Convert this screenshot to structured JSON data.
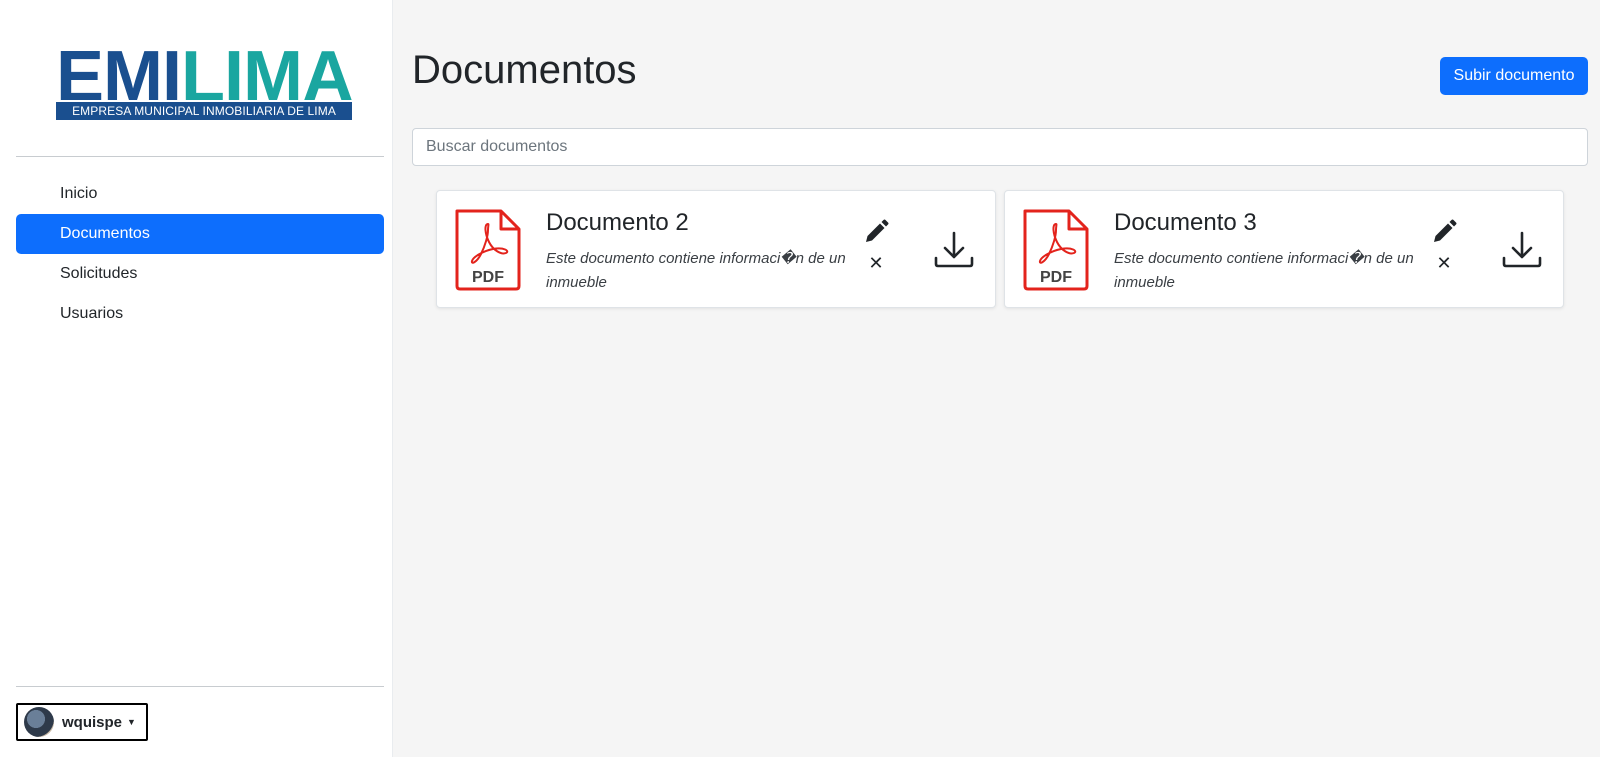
{
  "sidebar": {
    "logo": {
      "emi": "EMI",
      "lima": "LIMA",
      "subtitle": "EMPRESA MUNICIPAL INMOBILIARIA DE LIMA"
    },
    "nav": [
      {
        "label": "Inicio",
        "active": false
      },
      {
        "label": "Documentos",
        "active": true
      },
      {
        "label": "Solicitudes",
        "active": false
      },
      {
        "label": "Usuarios",
        "active": false
      }
    ],
    "user": {
      "name": "wquispe"
    }
  },
  "main": {
    "title": "Documentos",
    "upload_label": "Subir documento",
    "search_placeholder": "Buscar documentos",
    "documents": [
      {
        "title": "Documento 2",
        "description": "Este documento contiene informaci�n de un inmueble",
        "icon_label": "PDF"
      },
      {
        "title": "Documento 3",
        "description": "Este documento contiene informaci�n de un inmueble",
        "icon_label": "PDF"
      }
    ]
  },
  "colors": {
    "primary": "#0d6efd",
    "logo_blue": "#1a4f8f",
    "logo_teal": "#1aa6a0",
    "pdf_red": "#e3231c"
  },
  "icons": {
    "edit": "pencil-icon",
    "delete": "close-icon",
    "download": "download-icon",
    "file": "pdf-file-icon",
    "user_menu": "chevron-down-icon"
  }
}
